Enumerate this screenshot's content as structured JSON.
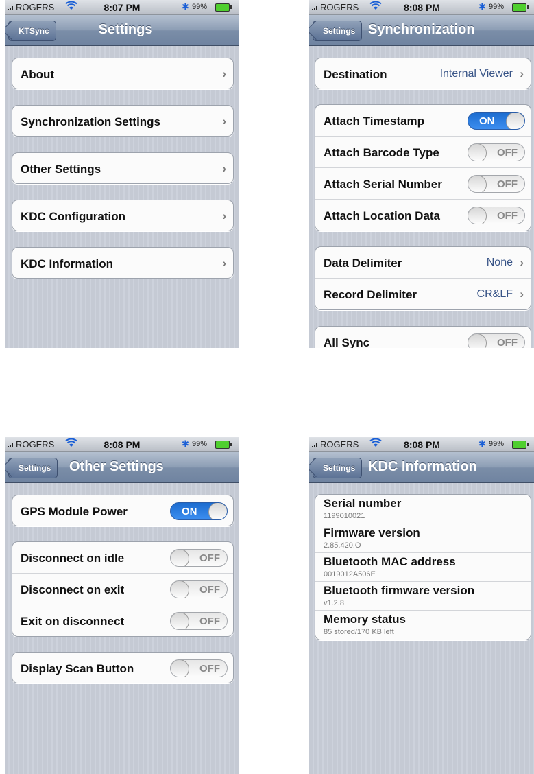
{
  "colors": {
    "accent_on": "#1c6ccf",
    "value_text": "#385487",
    "navbar": "#7b8ea8"
  },
  "status": {
    "carrier": "ROGERS",
    "battery": "99%"
  },
  "screen1": {
    "time": "8:07 PM",
    "back": "KTSync",
    "title": "Settings",
    "items": [
      "About",
      "Synchronization Settings",
      "Other Settings",
      "KDC Configuration",
      "KDC Information"
    ]
  },
  "screen2": {
    "time": "8:08 PM",
    "back": "Settings",
    "title": "Synchronization",
    "destination": {
      "label": "Destination",
      "value": "Internal Viewer"
    },
    "toggles": [
      {
        "label": "Attach Timestamp",
        "state": "ON"
      },
      {
        "label": "Attach Barcode Type",
        "state": "OFF"
      },
      {
        "label": "Attach Serial Number",
        "state": "OFF"
      },
      {
        "label": "Attach Location Data",
        "state": "OFF"
      }
    ],
    "delimiters": [
      {
        "label": "Data Delimiter",
        "value": "None"
      },
      {
        "label": "Record Delimiter",
        "value": "CR&LF"
      }
    ],
    "all_sync": {
      "label": "All Sync",
      "state": "OFF"
    }
  },
  "screen3": {
    "time": "8:08 PM",
    "back": "Settings",
    "title": "Other Settings",
    "gps": {
      "label": "GPS Module Power",
      "state": "ON"
    },
    "toggles": [
      {
        "label": "Disconnect on idle",
        "state": "OFF"
      },
      {
        "label": "Disconnect on exit",
        "state": "OFF"
      },
      {
        "label": "Exit on disconnect",
        "state": "OFF"
      }
    ],
    "scan": {
      "label": "Display Scan Button",
      "state": "OFF"
    }
  },
  "screen4": {
    "time": "8:08 PM",
    "back": "Settings",
    "title": "KDC Information",
    "items": [
      {
        "key": "Serial number",
        "value": "1199010021"
      },
      {
        "key": "Firmware version",
        "value": "2.85.420.O"
      },
      {
        "key": "Bluetooth MAC address",
        "value": "0019012A506E"
      },
      {
        "key": "Bluetooth firmware version",
        "value": "v1.2.8"
      },
      {
        "key": "Memory status",
        "value": "85 stored/170 KB left"
      }
    ]
  }
}
